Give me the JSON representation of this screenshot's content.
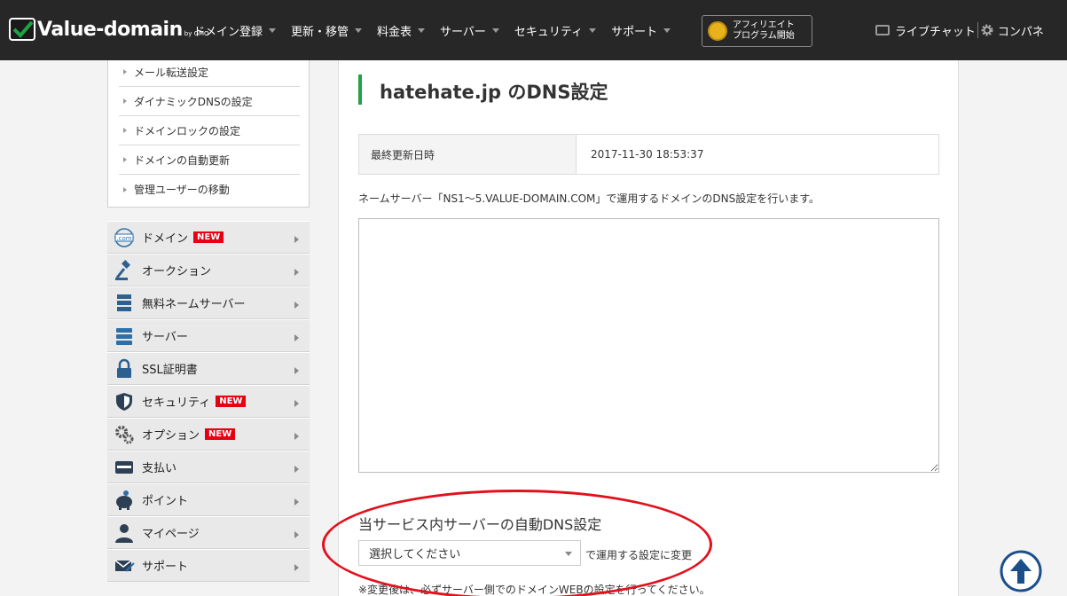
{
  "header": {
    "logo_text": "Value-domain",
    "logo_sub": "by GMO",
    "nav": [
      {
        "label": "ドメイン登録"
      },
      {
        "label": "更新・移管"
      },
      {
        "label": "料金表"
      },
      {
        "label": "サーバー"
      },
      {
        "label": "セキュリティ"
      },
      {
        "label": "サポート"
      }
    ],
    "affiliate": {
      "line1": "アフィリエイト",
      "line2": "プログラム開始"
    },
    "live_chat": "ライブチャット",
    "control_panel": "コンパネ"
  },
  "sidebar": {
    "links": [
      {
        "label": "メール転送設定"
      },
      {
        "label": "ダイナミックDNSの設定"
      },
      {
        "label": "ドメインロックの設定"
      },
      {
        "label": "ドメインの自動更新"
      },
      {
        "label": "管理ユーザーの移動"
      }
    ],
    "menu": [
      {
        "label": "ドメイン",
        "badge": "NEW",
        "icon": "globe-com-icon"
      },
      {
        "label": "オークション",
        "icon": "gavel-icon"
      },
      {
        "label": "無料ネームサーバー",
        "icon": "server-stack-icon"
      },
      {
        "label": "サーバー",
        "icon": "server-icon"
      },
      {
        "label": "SSL証明書",
        "icon": "lock-icon"
      },
      {
        "label": "セキュリティ",
        "badge": "NEW",
        "icon": "shield-icon"
      },
      {
        "label": "オプション",
        "badge": "NEW",
        "icon": "gears-icon"
      },
      {
        "label": "支払い",
        "icon": "card-icon"
      },
      {
        "label": "ポイント",
        "icon": "piggy-bank-icon"
      },
      {
        "label": "マイページ",
        "icon": "user-icon"
      },
      {
        "label": "サポート",
        "icon": "mail-icon"
      }
    ]
  },
  "main": {
    "title": "hatehate.jp のDNS設定",
    "last_updated_label": "最終更新日時",
    "last_updated_value": "2017-11-30 18:53:37",
    "description": "ネームサーバー「NS1～5.VALUE-DOMAIN.COM」で運用するドメインのDNS設定を行います。",
    "dns_records": "",
    "auto_dns_title": "当サービス内サーバーの自動DNS設定",
    "select_value": "選択してください",
    "select_suffix": "で運用する設定に変更",
    "note": "※変更後は、必ずサーバー側でのドメインWEBの設定を行ってください。"
  },
  "colors": {
    "accent_green": "#1ea345",
    "badge_red": "#e60012",
    "annotation_red": "#e3101c",
    "header_bg": "#272727"
  }
}
